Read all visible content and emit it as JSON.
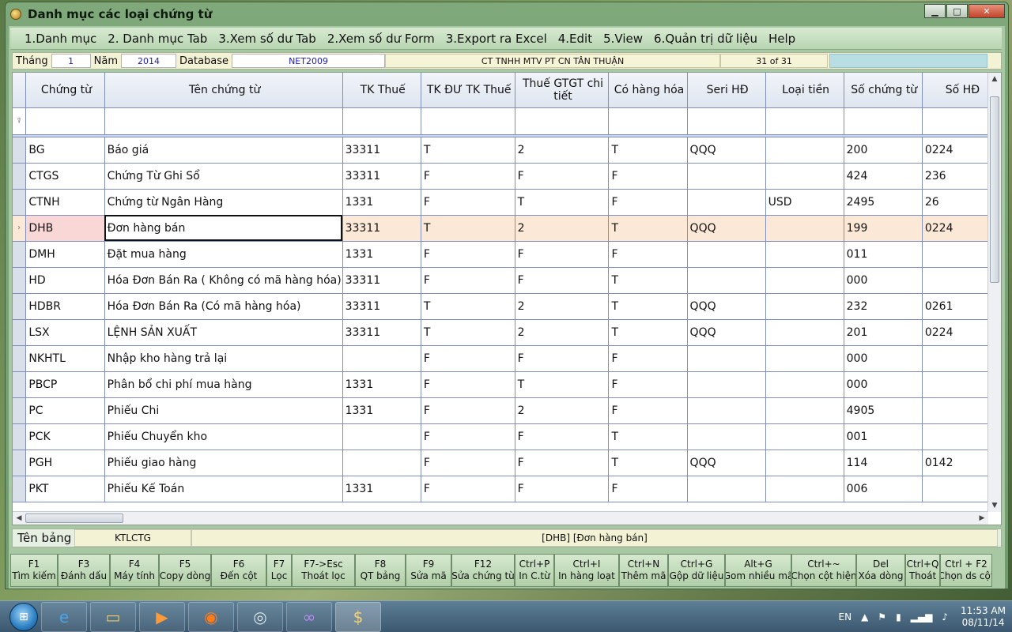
{
  "window": {
    "title": "Danh mục các loại chứng từ",
    "controls": {
      "minimize": "▁",
      "maximize": "□",
      "close": "✕"
    }
  },
  "menu": [
    {
      "label": "1.Danh mục"
    },
    {
      "label": "2. Danh mục Tab"
    },
    {
      "label": "3.Xem số dư Tab"
    },
    {
      "label": "2.Xem số dư Form"
    },
    {
      "label": "3.Export ra Excel"
    },
    {
      "label": "4.Edit"
    },
    {
      "label": "5.View"
    },
    {
      "label": "6.Quản trị dữ liệu"
    },
    {
      "label": "Help"
    }
  ],
  "infobar": {
    "thang_label": "Tháng",
    "thang_value": "1",
    "nam_label": "Năm",
    "nam_value": "2014",
    "database_label": "Database",
    "database_value": "NET2009",
    "company": "CT TNHH MTV PT CN TÂN THUẬN",
    "record_count": "31 of 31"
  },
  "grid": {
    "columns": [
      "Chứng từ",
      "Tên chứng từ",
      "TK Thuế",
      "TK ĐƯ TK Thuế",
      "Thuế GTGT chi tiết",
      "Có hàng hóa",
      "Seri HĐ",
      "Loại tiền",
      "Số chứng từ",
      "Số HĐ"
    ],
    "rows": [
      [
        "BG",
        "Báo giá",
        "33311",
        "T",
        "2",
        "T",
        "QQQ",
        "",
        "200",
        "0224"
      ],
      [
        "CTGS",
        "Chứng Từ Ghi Sổ",
        "33311",
        "F",
        "F",
        "F",
        "",
        "",
        "424",
        "236"
      ],
      [
        "CTNH",
        "Chứng từ  Ngân Hàng",
        "1331",
        "F",
        "T",
        "F",
        "",
        "USD",
        "2495",
        "26"
      ],
      [
        "DHB",
        "Đơn hàng bán",
        "33311",
        "T",
        "2",
        "T",
        "QQQ",
        "",
        "199",
        "0224"
      ],
      [
        "DMH",
        "Đặt mua hàng",
        "1331",
        "F",
        "F",
        "F",
        "",
        "",
        "011",
        ""
      ],
      [
        "HD",
        "Hóa Đơn Bán Ra ( Không có mã hàng hóa)",
        "33311",
        "F",
        "F",
        "T",
        "",
        "",
        "000",
        ""
      ],
      [
        "HDBR",
        "Hóa Đơn Bán Ra (Có mã hàng hóa)",
        "33311",
        "T",
        "2",
        "T",
        "QQQ",
        "",
        "232",
        "0261"
      ],
      [
        "LSX",
        "LỆNH SẢN XUẤT",
        "33311",
        "T",
        "2",
        "T",
        "QQQ",
        "",
        "201",
        "0224"
      ],
      [
        "NKHTL",
        "Nhập kho hàng trả lại",
        "",
        "F",
        "F",
        "F",
        "",
        "",
        "000",
        ""
      ],
      [
        "PBCP",
        "Phân bổ chi phí mua hàng",
        "1331",
        "F",
        "T",
        "F",
        "",
        "",
        "000",
        ""
      ],
      [
        "PC",
        "Phiếu Chi",
        "1331",
        "F",
        "2",
        "F",
        "",
        "",
        "4905",
        ""
      ],
      [
        "PCK",
        "Phiếu Chuyển kho",
        "",
        "F",
        "F",
        "T",
        "",
        "",
        "001",
        ""
      ],
      [
        "PGH",
        "Phiếu giao hàng",
        "",
        "F",
        "F",
        "T",
        "QQQ",
        "",
        "114",
        "0142"
      ],
      [
        "PKT",
        "Phiếu Kế Toán",
        "1331",
        "F",
        "F",
        "F",
        "",
        "",
        "006",
        ""
      ]
    ],
    "selected_row": 3
  },
  "status": {
    "ten_bang_label": "Tên bảng",
    "ten_bang_value": "KTLCTG",
    "current_record": "[DHB]  [Đơn hàng bán]"
  },
  "fkeys": [
    {
      "key": "F1",
      "label": "Tìm kiếm"
    },
    {
      "key": "F3",
      "label": "Đánh dấu"
    },
    {
      "key": "F4",
      "label": "Máy tính"
    },
    {
      "key": "F5",
      "label": "Copy dòng"
    },
    {
      "key": "F6",
      "label": "Đến cột"
    },
    {
      "key": "F7",
      "label": "Lọc"
    },
    {
      "key": "F7->Esc",
      "label": "Thoát lọc"
    },
    {
      "key": "F8",
      "label": "QT bảng"
    },
    {
      "key": "F9",
      "label": "Sửa mã"
    },
    {
      "key": "F12",
      "label": "Sửa chứng từ"
    },
    {
      "key": "Ctrl+P",
      "label": "In C.từ"
    },
    {
      "key": "Ctrl+I",
      "label": "In hàng loạt"
    },
    {
      "key": "Ctrl+N",
      "label": "Thêm mã"
    },
    {
      "key": "Ctrl+G",
      "label": "Gộp dữ liệu"
    },
    {
      "key": "Alt+G",
      "label": "Gom nhiều mã"
    },
    {
      "key": "Ctrl+~",
      "label": "Chọn cột hiện"
    },
    {
      "key": "Del",
      "label": "Xóa dòng"
    },
    {
      "key": "Ctrl+Q",
      "label": "Thoát"
    },
    {
      "key": "Ctrl + F2",
      "label": "Chọn ds cột"
    }
  ],
  "taskbar": {
    "language": "EN",
    "time": "11:53 AM",
    "date": "08/11/14"
  }
}
